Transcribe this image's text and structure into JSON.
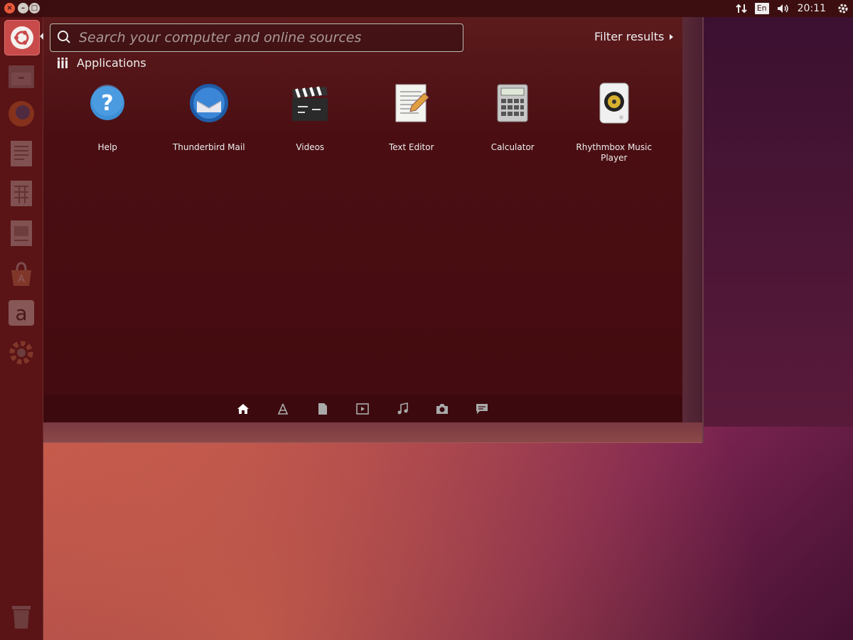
{
  "panel": {
    "clock": "20:11",
    "keyboard_layout": "En",
    "icons": [
      "network-icon",
      "volume-icon",
      "session-gear-icon"
    ]
  },
  "launcher": {
    "items": [
      {
        "name": "dash-home",
        "icon": "ubuntu-logo-icon"
      },
      {
        "name": "files",
        "icon": "file-cabinet-icon"
      },
      {
        "name": "firefox",
        "icon": "firefox-icon"
      },
      {
        "name": "writer",
        "icon": "document-icon"
      },
      {
        "name": "calc",
        "icon": "spreadsheet-icon"
      },
      {
        "name": "impress",
        "icon": "presentation-icon"
      },
      {
        "name": "software-center",
        "icon": "software-center-icon"
      },
      {
        "name": "amazon",
        "icon": "amazon-icon"
      },
      {
        "name": "settings",
        "icon": "system-settings-icon"
      },
      {
        "name": "trash",
        "icon": "trash-icon"
      }
    ],
    "amazon_letter": "a"
  },
  "dash": {
    "search_placeholder": "Search your computer and online sources",
    "filter_label": "Filter results",
    "section_title": "Applications",
    "apps": [
      {
        "label": "Help",
        "icon": "help-icon"
      },
      {
        "label": "Thunderbird Mail",
        "icon": "thunderbird-icon"
      },
      {
        "label": "Videos",
        "icon": "clapperboard-icon"
      },
      {
        "label": "Text Editor",
        "icon": "text-editor-icon"
      },
      {
        "label": "Calculator",
        "icon": "calculator-icon"
      },
      {
        "label": "Rhythmbox Music Player",
        "icon": "speaker-icon"
      }
    ],
    "lenses": [
      {
        "name": "home",
        "icon": "home-icon",
        "active": true
      },
      {
        "name": "applications",
        "icon": "applications-icon"
      },
      {
        "name": "files",
        "icon": "file-icon"
      },
      {
        "name": "video",
        "icon": "video-icon"
      },
      {
        "name": "music",
        "icon": "music-icon"
      },
      {
        "name": "photos",
        "icon": "camera-icon"
      },
      {
        "name": "social",
        "icon": "speech-bubble-icon"
      }
    ]
  },
  "colors": {
    "panel": "#3c0e10",
    "launcher": "#5a1416",
    "dash": "#4a0e12",
    "accent": "#e8593b"
  }
}
